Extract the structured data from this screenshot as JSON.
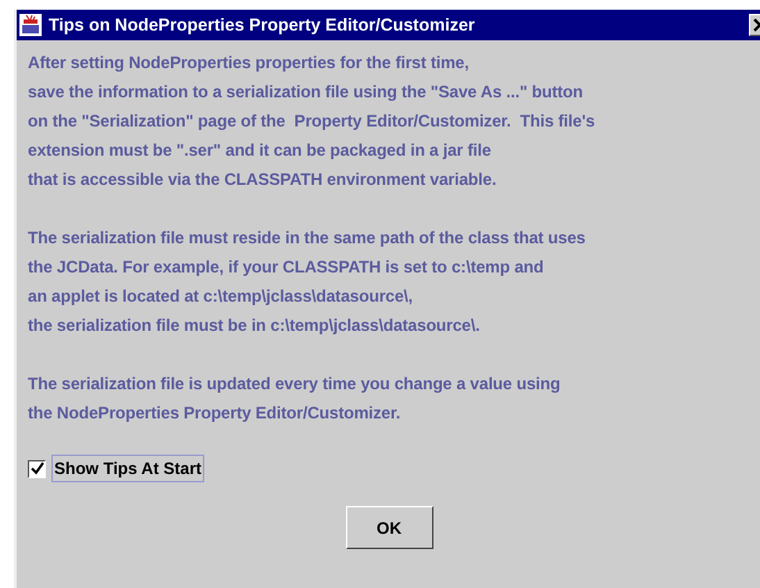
{
  "window": {
    "title": "Tips on NodeProperties Property Editor/Customizer"
  },
  "paragraphs": [
    {
      "lines": [
        "After setting NodeProperties properties for the first time,",
        "save the information to a serialization file using the \"Save As ...\" button",
        "on the \"Serialization\" page of the  Property Editor/Customizer.  This file's",
        "extension must be \".ser\" and it can be packaged in a jar file",
        "that is accessible via the CLASSPATH environment variable."
      ]
    },
    {
      "lines": [
        "The serialization file must reside in the same path of the class that uses",
        "the JCData. For example, if your CLASSPATH is set to c:\\temp and",
        "an applet is located at c:\\temp\\jclass\\datasource\\,",
        "the serialization file must be in c:\\temp\\jclass\\datasource\\."
      ]
    },
    {
      "lines": [
        "The serialization file is updated every time you change a value using",
        "the NodeProperties Property Editor/Customizer."
      ]
    }
  ],
  "show_tips": {
    "label": "Show Tips At Start",
    "checked": true
  },
  "buttons": [
    "OK"
  ]
}
